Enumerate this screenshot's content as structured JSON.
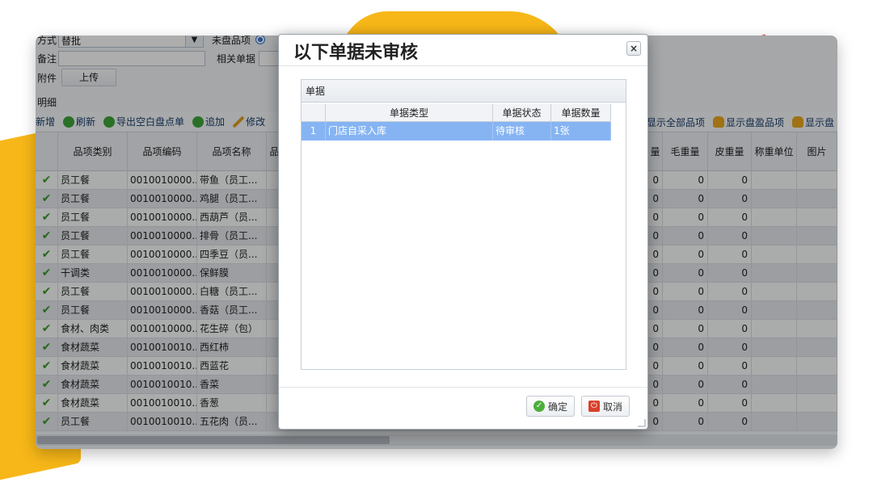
{
  "form": {
    "method_label": "方式",
    "method_value": "替批",
    "unmatched_label": "未盘品项",
    "note_label": "备注",
    "related_label": "相关单据",
    "attach_label": "附件",
    "upload_label": "上传",
    "detail_label": "明细"
  },
  "toolbar": {
    "add": "新增",
    "refresh": "刷新",
    "export": "导出空白盘点单",
    "append": "追加",
    "edit": "修改",
    "show_all": "显示全部品项",
    "show_profit": "显示盘盈品项",
    "show_loss": "显示盘"
  },
  "grid": {
    "headers": {
      "category": "品项类别",
      "code": "品项编码",
      "name": "品项名称",
      "partial": "品",
      "qty_partial": "量",
      "gross": "毛重量",
      "tare": "皮重量",
      "unit": "称重单位",
      "image": "图片"
    },
    "rows": [
      {
        "category": "员工餐",
        "code": "0010010000...",
        "name": "带鱼（员工...",
        "q": "0",
        "gross": "0",
        "tare": "0"
      },
      {
        "category": "员工餐",
        "code": "0010010000...",
        "name": "鸡腿（员工...",
        "q": "0",
        "gross": "0",
        "tare": "0"
      },
      {
        "category": "员工餐",
        "code": "0010010000...",
        "name": "西葫芦（员...",
        "q": "0",
        "gross": "0",
        "tare": "0"
      },
      {
        "category": "员工餐",
        "code": "0010010000...",
        "name": "排骨（员工...",
        "q": "0",
        "gross": "0",
        "tare": "0"
      },
      {
        "category": "员工餐",
        "code": "0010010000...",
        "name": "四季豆（员...",
        "q": "0",
        "gross": "0",
        "tare": "0"
      },
      {
        "category": "干调类",
        "code": "0010010000...",
        "name": "保鲜膜",
        "q": "0",
        "gross": "0",
        "tare": "0"
      },
      {
        "category": "员工餐",
        "code": "0010010000...",
        "name": "白糖（员工...",
        "q": "0",
        "gross": "0",
        "tare": "0"
      },
      {
        "category": "员工餐",
        "code": "0010010000...",
        "name": "香菇（员工...",
        "q": "0",
        "gross": "0",
        "tare": "0"
      },
      {
        "category": "食材、肉类",
        "code": "0010010000...",
        "name": "花生碎（包）",
        "q": "0",
        "gross": "0",
        "tare": "0"
      },
      {
        "category": "食材蔬菜",
        "code": "0010010010...",
        "name": "西红柿",
        "q": "0",
        "gross": "0",
        "tare": "0"
      },
      {
        "category": "食材蔬菜",
        "code": "0010010010...",
        "name": "西蓝花",
        "q": "0",
        "gross": "0",
        "tare": "0"
      },
      {
        "category": "食材蔬菜",
        "code": "0010010010...",
        "name": "香菜",
        "q": "0",
        "gross": "0",
        "tare": "0"
      },
      {
        "category": "食材蔬菜",
        "code": "0010010010...",
        "name": "香葱",
        "q": "0",
        "gross": "0",
        "tare": "0"
      },
      {
        "category": "员工餐",
        "code": "0010010010...",
        "name": "五花肉（员...",
        "q": "0",
        "gross": "0",
        "tare": "0"
      }
    ]
  },
  "dialog": {
    "title": "以下单据未审核",
    "close": "×",
    "panel_title": "单据",
    "columns": {
      "type": "单据类型",
      "status": "单据状态",
      "count": "单据数量"
    },
    "rows": [
      {
        "index": "1",
        "type": "门店自采入库",
        "status": "待审核",
        "count": "1张"
      }
    ],
    "ok_label": "确定",
    "cancel_label": "取消"
  }
}
